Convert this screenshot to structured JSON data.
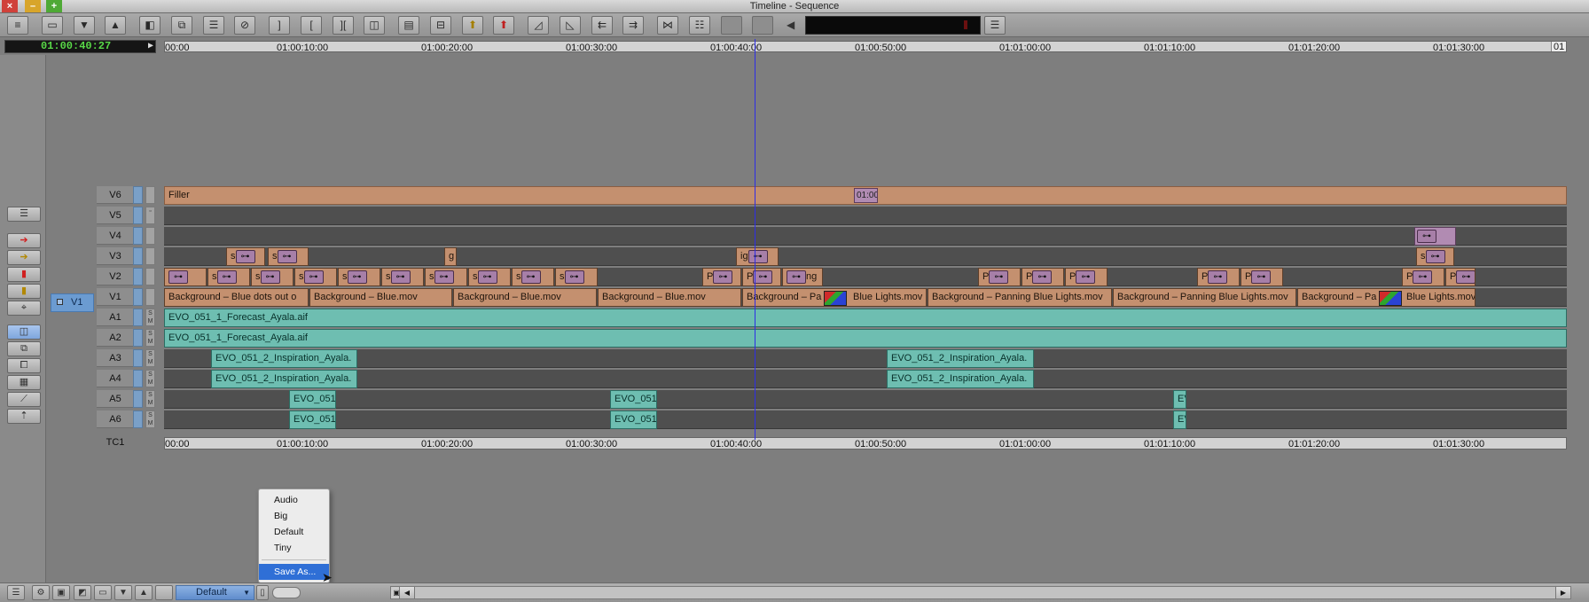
{
  "window": {
    "title": "Timeline - Sequence"
  },
  "toolbar": {
    "icons": [
      "sliders-icon",
      "bin-icon",
      "mark-down-icon",
      "mark-up-icon",
      "clip-icon",
      "source-icon",
      "segment-icon",
      "no-entry-icon",
      "mark-in-icon",
      "mark-out-icon",
      "mark-clip-icon",
      "clear-marks-icon",
      "overwrite-icon",
      "splice-icon",
      "lift-icon",
      "extract-icon",
      "trim-icon",
      "trim-in-icon",
      "step-back-icon",
      "step-forward-icon",
      "match-frame-icon",
      "toggle-icon",
      "blank-1",
      "blank-2",
      "volume-icon",
      "audio-meter-icon"
    ]
  },
  "timecode": {
    "value": "01:00:40:27"
  },
  "ruler": {
    "labels": [
      "00:00",
      "01:00:10:00",
      "01:00:20:00",
      "01:00:30:00",
      "01:00:40:00",
      "01:00:50:00",
      "01:01:00:00",
      "01:01:10:00",
      "01:01:20:00",
      "01:01:30:00"
    ],
    "end_label": "01"
  },
  "tracks": {
    "V6": {
      "label": "V6"
    },
    "V5": {
      "label": "V5"
    },
    "V4": {
      "label": "V4"
    },
    "V3": {
      "label": "V3"
    },
    "V2": {
      "label": "V2"
    },
    "V1": {
      "label": "V1"
    },
    "A1": {
      "label": "A1"
    },
    "A2": {
      "label": "A2"
    },
    "A3": {
      "label": "A3"
    },
    "A4": {
      "label": "A4"
    },
    "A5": {
      "label": "A5"
    },
    "A6": {
      "label": "A6"
    },
    "TC1": {
      "label": "TC1"
    }
  },
  "source_track": {
    "label": "V1"
  },
  "clips": {
    "filler": "Filler",
    "v6_tc": "01:00",
    "v1": [
      "Background – Blue dots out o",
      "Background – Blue.mov",
      "Background – Blue.mov",
      "Background – Blue.mov",
      "Background – Pa",
      "Blue Lights.mov",
      "Background – Panning Blue Lights.mov",
      "Background – Panning Blue Lights.mov",
      "Background – Pa",
      "Blue Lights.mov"
    ],
    "a1": "EVO_051_1_Forecast_Ayala.aif",
    "a2": "EVO_051_1_Forecast_Ayala.aif",
    "a3": [
      "EVO_051_2_Inspiration_Ayala.",
      "EVO_051_2_Inspiration_Ayala."
    ],
    "a4": [
      "EVO_051_2_Inspiration_Ayala.",
      "EVO_051_2_Inspiration_Ayala."
    ],
    "a5": [
      "EVO_051",
      "EVO_051",
      "EV"
    ],
    "a6": [
      "EVO_051",
      "EVO_051",
      "EV"
    ],
    "key_glyph": "⊶",
    "small_letters": {
      "s": "s",
      "r": "r",
      "p": "P",
      "ng": "ng",
      "g": "g",
      "ig": "ig"
    }
  },
  "menu": {
    "items": [
      "Audio",
      "Big",
      "Default",
      "Tiny"
    ],
    "save_as": "Save As..."
  },
  "bottom": {
    "preset": "Default"
  },
  "colors": {
    "video_clip": "#c4906f",
    "audio_clip": "#6ebeb1",
    "effect_clip": "#b18bb2",
    "playhead": "#2e2ee6",
    "timecode_text": "#59d948",
    "menu_highlight": "#2f6fd6"
  }
}
